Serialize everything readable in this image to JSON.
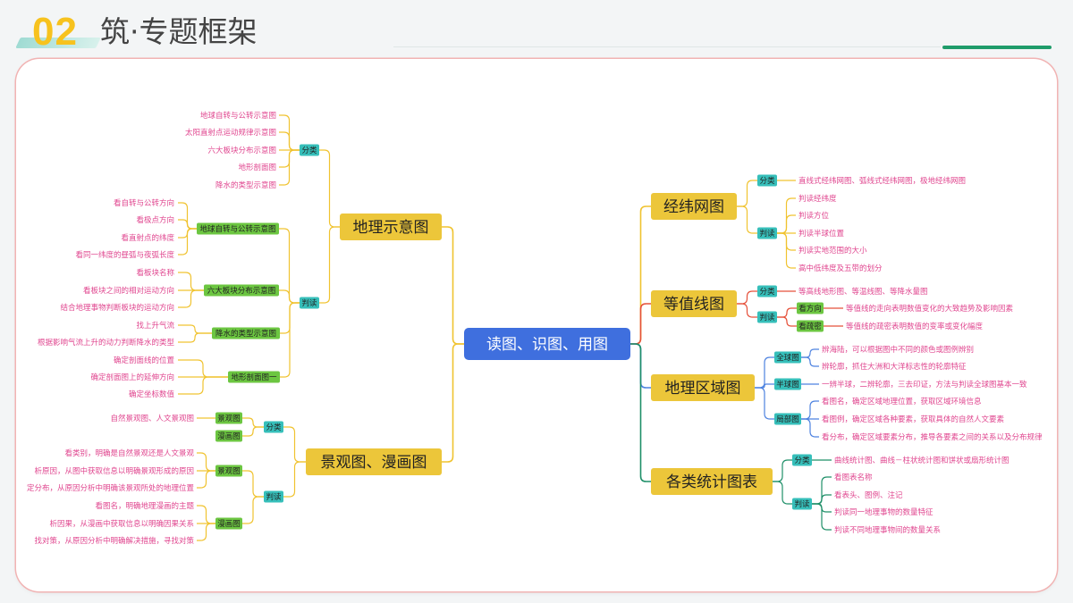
{
  "header": {
    "number": "02",
    "title": "筑·专题框架"
  },
  "center": "读图、识图、用图",
  "left": [
    {
      "title": "地理示意图",
      "groups": [
        {
          "label": "分类",
          "items": [
            "地球自转与公转示意图",
            "太阳直射点运动规律示意图",
            "六大板块分布示意图",
            "地形剖面图",
            "降水的类型示意图"
          ]
        },
        {
          "label": "判读",
          "subs": [
            {
              "label": "地球自转与公转示意图",
              "items": [
                "看自转与公转方向",
                "看极点方向",
                "看直射点的纬度",
                "看同一纬度的昼弧与夜弧长度"
              ]
            },
            {
              "label": "六大板块分布示意图",
              "items": [
                "看板块名称",
                "看板块之间的相对运动方向",
                "结合地理事物判断板块的运动方向"
              ]
            },
            {
              "label": "降水的类型示意图",
              "items": [
                "找上升气流",
                "根据影响气流上升的动力判断降水的类型"
              ]
            },
            {
              "label": "地形剖面图一",
              "items": [
                "确定剖面线的位置",
                "确定剖面图上的延伸方向",
                "确定坐标数值"
              ]
            }
          ]
        }
      ]
    },
    {
      "title": "景观图、漫画图",
      "groups": [
        {
          "label": "分类",
          "subs": [
            {
              "label": "景观图",
              "items": [
                "自然景观图、人文景观图"
              ]
            },
            {
              "label": "漫画图",
              "items": []
            }
          ]
        },
        {
          "label": "判读",
          "subs": [
            {
              "label": "景观图",
              "items": [
                "看类别，明确是自然景观还是人文景观",
                "析原因，从图中获取信息以明确景观形成的原因",
                "定分布，从原因分析中明确该景观所处的地理位置"
              ]
            },
            {
              "label": "漫画图",
              "items": [
                "看图名，明确地理漫画的主题",
                "析因果，从漫画中获取信息以明确因果关系",
                "找对策，从原因分析中明确解决措施，寻找对策"
              ]
            }
          ]
        }
      ]
    }
  ],
  "right": [
    {
      "title": "经纬网图",
      "groups": [
        {
          "label": "分类",
          "items": [
            "直线式经纬网图、弧线式经纬网图，极地经纬网图"
          ]
        },
        {
          "label": "判读",
          "items": [
            "判读经纬度",
            "判读方位",
            "判读半球位置",
            "判读实地范围的大小",
            "高中低纬度及五带的划分"
          ]
        }
      ]
    },
    {
      "title": "等值线图",
      "groups": [
        {
          "label": "分类",
          "items": [
            "等高线地形图、等温线图、等降水量图"
          ]
        },
        {
          "label": "判读",
          "subs": [
            {
              "label": "看方向",
              "items": [
                "等值线的走向表明数值变化的大致趋势及影响因素"
              ]
            },
            {
              "label": "看疏密",
              "items": [
                "等值线的疏密表明数值的变率或变化幅度"
              ]
            }
          ]
        }
      ]
    },
    {
      "title": "地理区域图",
      "groups": [
        {
          "label": "全球图",
          "items": [
            "辨海陆，可以根据图中不同的颜色或图例辨别",
            "辨轮廓，抓住大洲和大洋标志性的轮廓特征"
          ]
        },
        {
          "label": "半球图",
          "items": [
            "一辨半球，二辨轮廓，三去印证，方法与判读全球图基本一致"
          ]
        },
        {
          "label": "局部图",
          "items": [
            "看图名，确定区域地理位置，获取区域环境信息",
            "看图例，确定区域各种要素，获取具体的自然人文要素",
            "看分布，确定区域要素分布，推导各要素之间的关系以及分布规律"
          ]
        }
      ]
    },
    {
      "title": "各类统计图表",
      "groups": [
        {
          "label": "分类",
          "items": [
            "曲线统计图、曲线－柱状统计图和饼状或扇形统计图"
          ]
        },
        {
          "label": "判读",
          "items": [
            "看图表名称",
            "看表头、图例、注记",
            "判读同一地理事物的数量特征",
            "判读不同地理事物间的数量关系"
          ]
        }
      ]
    }
  ],
  "colors": {
    "center": "#3f6fde",
    "title_box": "#ecc63a",
    "group_box": "#36bfba",
    "sub_box": "#6cc641",
    "leaf_text": "#e0468f",
    "branch_left": "#f0c330",
    "branch_right": [
      "#f0c330",
      "#e5503a",
      "#4d82e0",
      "#1e8f68"
    ]
  }
}
